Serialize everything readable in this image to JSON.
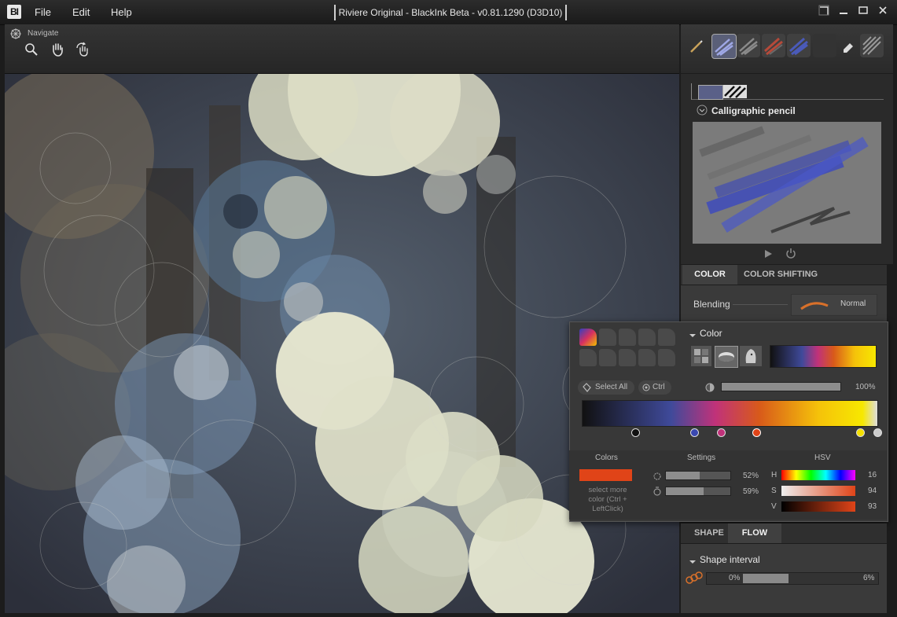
{
  "app": {
    "logo": "BI",
    "title": "Riviere Original - BlackInk Beta - v0.81.1290 (D3D10)"
  },
  "menu": [
    "File",
    "Edit",
    "Help"
  ],
  "window_controls": [
    "restore-panel-icon",
    "minimize-icon",
    "maximize-icon",
    "close-icon"
  ],
  "toolbar": {
    "navigate_label": "Navigate",
    "icons": [
      "zoom-icon",
      "hand-pan-icon",
      "rotate-hand-icon"
    ]
  },
  "brush_panel": {
    "brush_name": "Calligraphic pencil"
  },
  "color_tabs": {
    "color": "COLOR",
    "color_shifting": "COLOR SHIFTING"
  },
  "blending": {
    "label": "Blending",
    "value": "Normal"
  },
  "color_popup": {
    "header": "Color",
    "select_all": "Select All",
    "ctrl": "Ctrl",
    "opacity": "100%",
    "colors_label": "Colors",
    "settings_label": "Settings",
    "hsv_label": "HSV",
    "select_more": "select more color (Ctrl + LeftClick)",
    "setting1": "52%",
    "setting2": "59%",
    "setting1_value": 0.52,
    "setting2_value": 0.59,
    "h_label": "H",
    "s_label": "S",
    "v_label": "V",
    "h_value": "16",
    "s_value": "94",
    "v_value": "93",
    "selected_color": "#e04418"
  },
  "flow_tabs": {
    "shape": "SHAPE",
    "flow": "FLOW"
  },
  "shape_interval": {
    "label": "Shape interval",
    "min": "0%",
    "max": "6%"
  }
}
